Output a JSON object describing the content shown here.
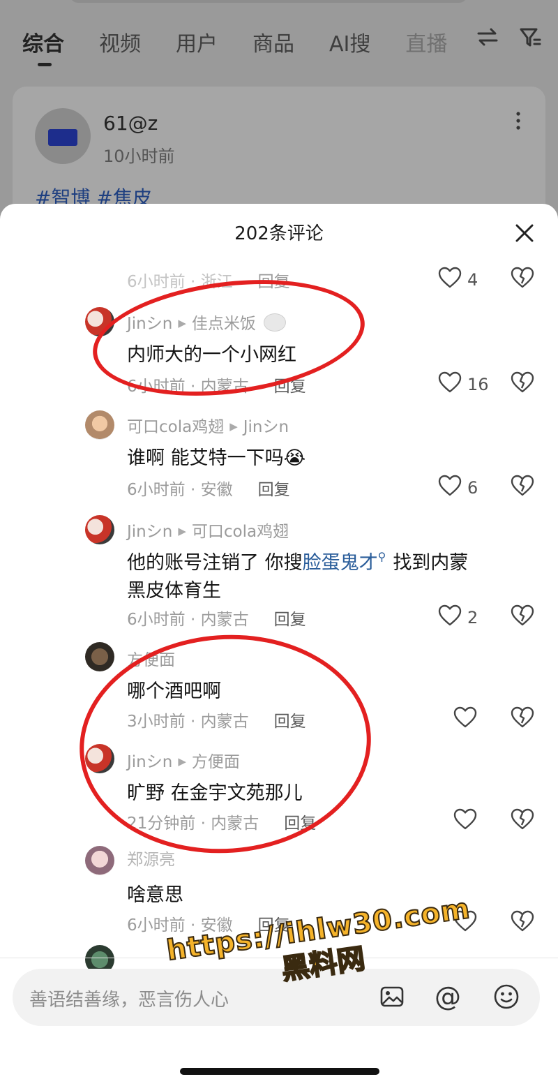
{
  "tabs": [
    "综合",
    "视频",
    "用户",
    "商品",
    "AI搜",
    "直播"
  ],
  "post": {
    "author": "61@z",
    "time": "10小时前",
    "tags": "#智博 #焦皮"
  },
  "sheet": {
    "title": "202条评论"
  },
  "partial_comment": {
    "meta": "6小时前 · 浙江",
    "reply": "回复",
    "likes": "4"
  },
  "comments": [
    {
      "user": "Jinシn",
      "reply_to": "佳点米饭",
      "text": "内师大的一个小网红",
      "time_loc": "6小时前 · 内蒙古",
      "reply": "回复",
      "likes": "16"
    },
    {
      "user": "可口cola鸡翅",
      "reply_to": "Jinシn",
      "text": "谁啊 能艾特一下吗😭",
      "time_loc": "6小时前 · 安徽",
      "reply": "回复",
      "likes": "6"
    },
    {
      "user": "Jinシn",
      "reply_to": "可口cola鸡翅",
      "text_before": "他的账号注销了 你搜",
      "text_link": "脸蛋鬼才",
      "text_after": "找到内蒙",
      "text_line2": "黑皮体育生",
      "time_loc": "6小时前 · 内蒙古",
      "reply": "回复",
      "likes": "2"
    },
    {
      "user": "方便面",
      "text": "哪个酒吧啊",
      "time_loc": "3小时前 · 内蒙古",
      "reply": "回复",
      "likes": ""
    },
    {
      "user": "Jinシn",
      "reply_to": "方便面",
      "text": "旷野 在金宇文苑那儿",
      "time_loc": "21分钟前 · 内蒙古",
      "reply": "回复",
      "likes": ""
    },
    {
      "user": "郑源亮",
      "text": "啥意思",
      "time_loc": "6小时前 · 安徽",
      "reply": "回复",
      "likes": ""
    }
  ],
  "input": {
    "placeholder": "善语结善缘，恶言伤人心"
  },
  "watermark": {
    "url": "https://ihlw30.com",
    "name": "黑料网"
  },
  "colors": {
    "accent_link": "#2a5d9a",
    "annotation_red": "#e32020",
    "watermark_gold": "#f5b32a"
  },
  "icons": [
    "swap-icon",
    "filter-icon",
    "more-vertical-icon",
    "close-icon",
    "heart-icon",
    "broken-heart-icon",
    "image-icon",
    "at-icon",
    "emoji-icon"
  ]
}
